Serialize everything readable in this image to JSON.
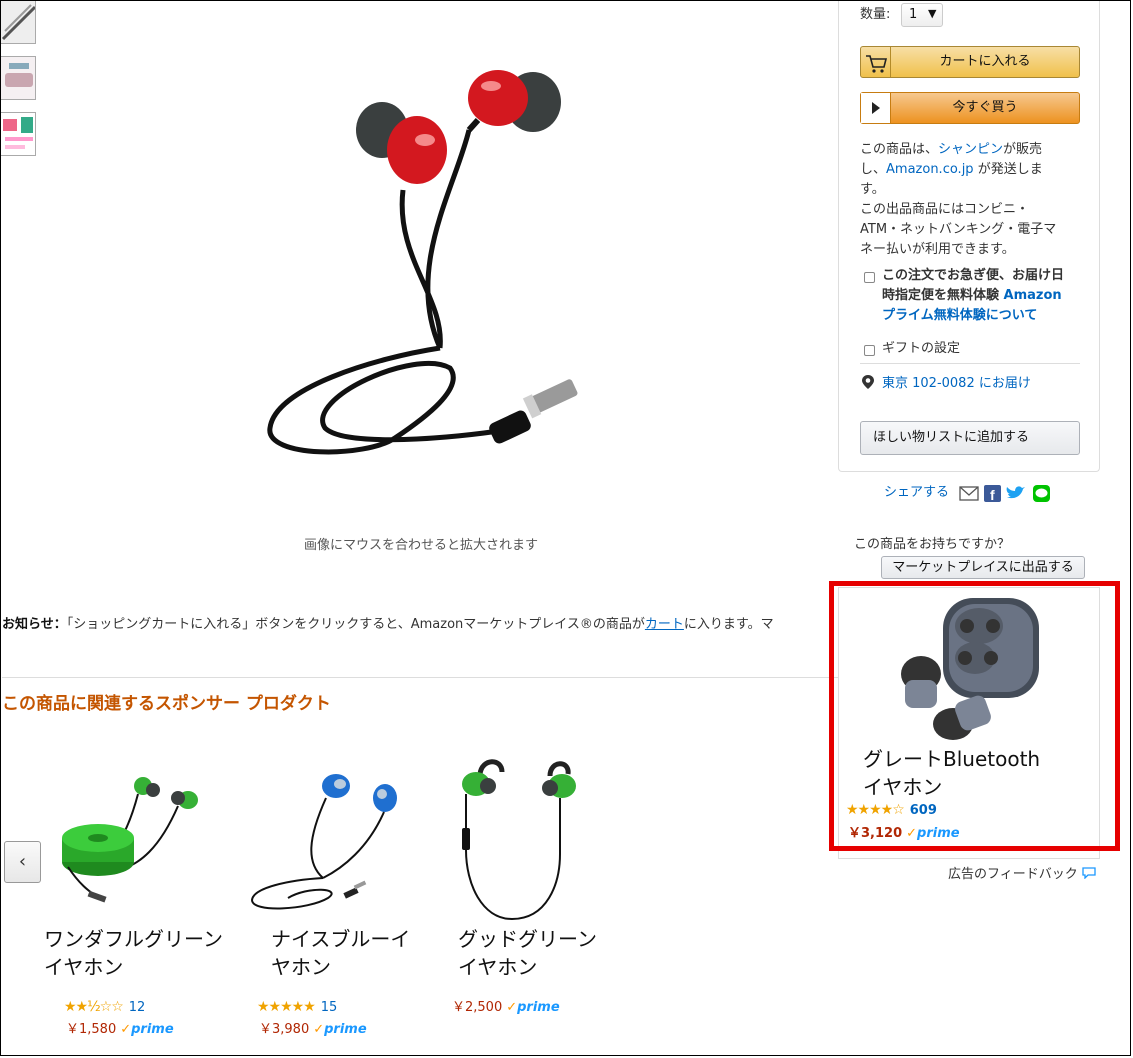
{
  "buybox": {
    "quantity_label": "数量:",
    "quantity_value": "1",
    "add_to_cart": "カートに入れる",
    "buy_now": "今すぐ買う",
    "seller_line1": "この商品は、",
    "seller_name": "シャンピン",
    "seller_line2": "が販売",
    "seller_line3": "し、",
    "shipper": "Amazon.co.jp",
    "seller_line4": "が発送しま",
    "seller_line5": "す。",
    "payment_line1": "この出品商品にはコンビニ・",
    "payment_line2": "ATM・ネットバンキング・電子マ",
    "payment_line3": "ネー払いが利用できます。",
    "prime_bold1": "この注文でお急ぎ便、お届け日",
    "prime_bold2": "時指定便を無料体験",
    "prime_link1": "Amazon",
    "prime_link2": "プライム無料体験について",
    "gift_label": "ギフトの設定",
    "delivery_location": "東京 102-0082 にお届け",
    "wishlist_button": "ほしい物リストに追加する"
  },
  "share": {
    "label": "シェアする"
  },
  "sell": {
    "question": "この商品をお持ちですか？",
    "button": "マーケットプレイスに出品する"
  },
  "image_caption": "画像にマウスを合わせると拡大されます",
  "notice": {
    "label": "お知らせ：",
    "text_before": "「ショッピングカートに入れる」ボタンをクリックすると、Amazonマーケットプレイス®の商品が",
    "link": "カート",
    "text_after": "に入ります。マ"
  },
  "sponsored": {
    "title": "この商品に関連するスポンサー プロダクト",
    "products": [
      {
        "title_l1": "ワンダフルグリーン",
        "title_l2": "イヤホン",
        "stars": "★★½☆☆",
        "count": "12",
        "price": "￥1,580",
        "prime": "prime"
      },
      {
        "title_l1": "ナイスブルーイ",
        "title_l2": "ヤホン",
        "stars": "★★★★★",
        "count": "15",
        "price": "￥3,980",
        "prime": "prime"
      },
      {
        "title_l1": "グッドグリーン",
        "title_l2": "イヤホン",
        "stars": "",
        "count": "",
        "price": "￥2,500",
        "prime": "prime"
      }
    ]
  },
  "ad": {
    "title_l1": "グレートBluetooth",
    "title_l2": "イヤホン",
    "stars": "★★★★☆",
    "count": "609",
    "price": "￥3,120",
    "prime": "prime",
    "feedback": "広告のフィードバック"
  },
  "colors": {
    "highlight": "#e60000",
    "link": "#0066c0",
    "price": "#b12704",
    "section_title": "#c45500"
  }
}
